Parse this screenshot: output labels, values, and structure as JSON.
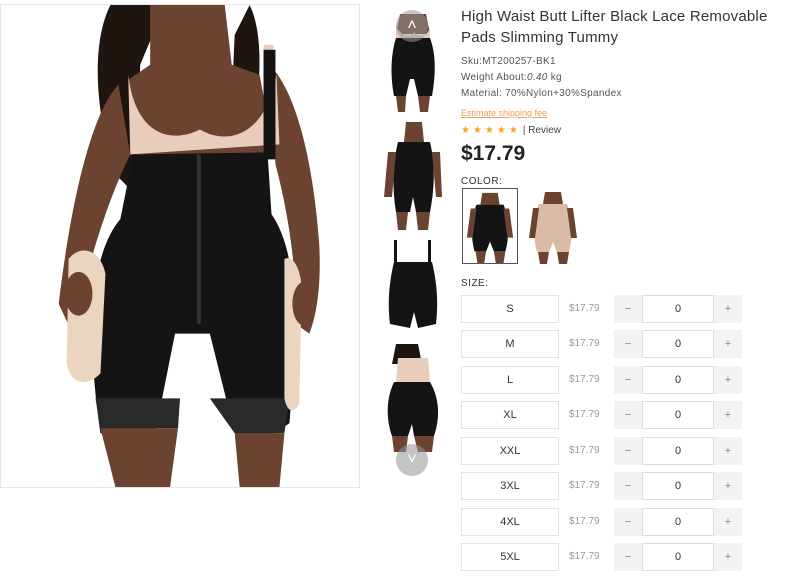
{
  "product": {
    "title_line1": "High Waist Butt Lifter Black Lace Removable",
    "title_line2": "Pads Slimming Tummy",
    "sku": "Sku:MT200257-BK1",
    "weight_label": "Weight About:",
    "weight_value": "0.40",
    "weight_unit": " kg",
    "material": "Material: 70%Nylon+30%Spandex",
    "shipping_link": "Estimate shipping fee",
    "stars": "★★★★★",
    "review_text": "| Review",
    "price": "$17.79"
  },
  "color_section": {
    "label": "COLOR:",
    "options": [
      {
        "name": "Black",
        "selected": true
      },
      {
        "name": "Nude",
        "selected": false
      }
    ]
  },
  "size_section": {
    "label": "SIZE:",
    "minus": "−",
    "plus": "+",
    "rows": [
      {
        "size": "S",
        "price": "$17.79",
        "qty": "0"
      },
      {
        "size": "M",
        "price": "$17.79",
        "qty": "0"
      },
      {
        "size": "L",
        "price": "$17.79",
        "qty": "0"
      },
      {
        "size": "XL",
        "price": "$17.79",
        "qty": "0"
      },
      {
        "size": "XXL",
        "price": "$17.79",
        "qty": "0"
      },
      {
        "size": "3XL",
        "price": "$17.79",
        "qty": "0"
      },
      {
        "size": "4XL",
        "price": "$17.79",
        "qty": "0"
      },
      {
        "size": "5XL",
        "price": "$17.79",
        "qty": "0"
      }
    ]
  },
  "gallery": {
    "up_icon": "˄",
    "down_icon": "˅"
  },
  "colors": {
    "garment_black": "#141414",
    "skin": "#6b4330",
    "bra_nude": "#e8cdbd",
    "pad": "#ecd5bf",
    "star": "#f5a623",
    "link": "#e8a05a"
  }
}
